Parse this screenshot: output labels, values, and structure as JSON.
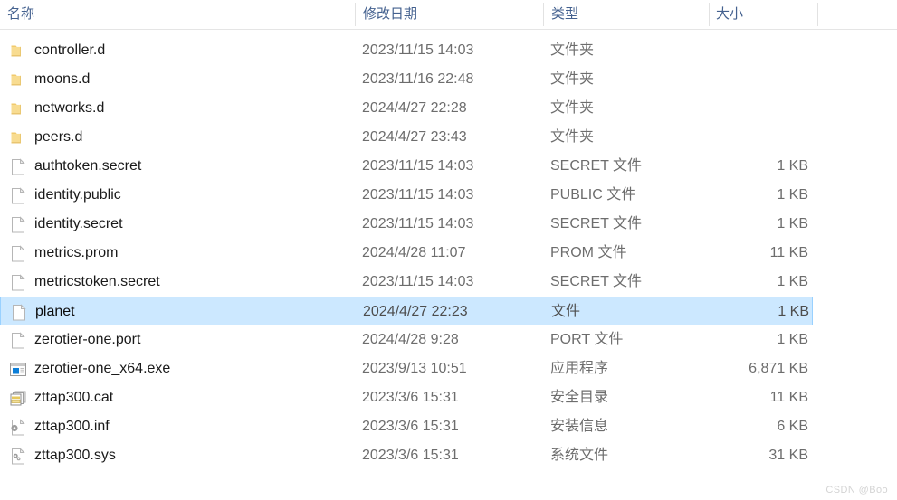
{
  "window": {
    "type": "file-explorer-list-view",
    "watermark": "CSDN @Boo"
  },
  "colors": {
    "header_text": "#44618f",
    "name_text": "#1a1a1a",
    "meta_text": "#6d6d6d",
    "selection_fill": "#cce8ff",
    "selection_border": "#99d1ff",
    "folder_icon": "#f5d67b",
    "exe_icon_accent": "#0b7ed8",
    "separator": "#e2e2e2"
  },
  "columns": [
    {
      "key": "name",
      "label": "名称"
    },
    {
      "key": "date",
      "label": "修改日期"
    },
    {
      "key": "type",
      "label": "类型"
    },
    {
      "key": "size",
      "label": "大小"
    }
  ],
  "rows": [
    {
      "icon": "folder-icon",
      "name": "controller.d",
      "date": "2023/11/15 14:03",
      "type": "文件夹",
      "size": "",
      "selected": false
    },
    {
      "icon": "folder-icon",
      "name": "moons.d",
      "date": "2023/11/16 22:48",
      "type": "文件夹",
      "size": "",
      "selected": false
    },
    {
      "icon": "folder-icon",
      "name": "networks.d",
      "date": "2024/4/27 22:28",
      "type": "文件夹",
      "size": "",
      "selected": false
    },
    {
      "icon": "folder-icon",
      "name": "peers.d",
      "date": "2024/4/27 23:43",
      "type": "文件夹",
      "size": "",
      "selected": false
    },
    {
      "icon": "generic-file-icon",
      "name": "authtoken.secret",
      "date": "2023/11/15 14:03",
      "type": "SECRET 文件",
      "size": "1 KB",
      "selected": false
    },
    {
      "icon": "generic-file-icon",
      "name": "identity.public",
      "date": "2023/11/15 14:03",
      "type": "PUBLIC 文件",
      "size": "1 KB",
      "selected": false
    },
    {
      "icon": "generic-file-icon",
      "name": "identity.secret",
      "date": "2023/11/15 14:03",
      "type": "SECRET 文件",
      "size": "1 KB",
      "selected": false
    },
    {
      "icon": "generic-file-icon",
      "name": "metrics.prom",
      "date": "2024/4/28 11:07",
      "type": "PROM 文件",
      "size": "11 KB",
      "selected": false
    },
    {
      "icon": "generic-file-icon",
      "name": "metricstoken.secret",
      "date": "2023/11/15 14:03",
      "type": "SECRET 文件",
      "size": "1 KB",
      "selected": false
    },
    {
      "icon": "generic-file-icon",
      "name": "planet",
      "date": "2024/4/27 22:23",
      "type": "文件",
      "size": "1 KB",
      "selected": true
    },
    {
      "icon": "generic-file-icon",
      "name": "zerotier-one.port",
      "date": "2024/4/28 9:28",
      "type": "PORT 文件",
      "size": "1 KB",
      "selected": false
    },
    {
      "icon": "application-icon",
      "name": "zerotier-one_x64.exe",
      "date": "2023/9/13 10:51",
      "type": "应用程序",
      "size": "6,871 KB",
      "selected": false
    },
    {
      "icon": "security-catalog-icon",
      "name": "zttap300.cat",
      "date": "2023/3/6 15:31",
      "type": "安全目录",
      "size": "11 KB",
      "selected": false
    },
    {
      "icon": "setup-information-icon",
      "name": "zttap300.inf",
      "date": "2023/3/6 15:31",
      "type": "安装信息",
      "size": "6 KB",
      "selected": false
    },
    {
      "icon": "system-file-icon",
      "name": "zttap300.sys",
      "date": "2023/3/6 15:31",
      "type": "系统文件",
      "size": "31 KB",
      "selected": false
    }
  ]
}
